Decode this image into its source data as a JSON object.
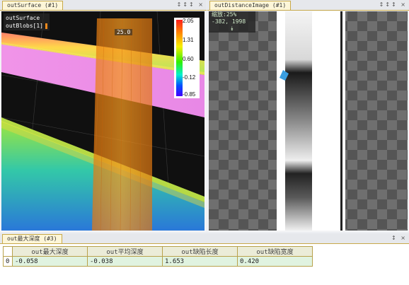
{
  "left_panel": {
    "tab_title": "outSurface (#1)",
    "controls": "↕↕↕ ×",
    "overlay_items": [
      "outSurface",
      "outBlobs[1]"
    ],
    "blob_label": "25.0",
    "colorbar": {
      "labels": [
        "2.05",
        "1.31",
        "0.60",
        "-0.12",
        "-0.85"
      ]
    }
  },
  "right_panel": {
    "tab_title": "outDistanceImage (#1)",
    "controls": "↕↕↕ ×",
    "info_lines": [
      "缩放:25%",
      "-382, 1998"
    ],
    "chevron": "⯯"
  },
  "bottom_panel": {
    "tab_title": "out最大深度 (#3)",
    "controls": "↕ ×",
    "table": {
      "headers": [
        "out最大深度",
        "out平均深度",
        "out缺陷长度",
        "out缺陷宽度"
      ],
      "rows": [
        {
          "index": "0",
          "cells": [
            "-0.058",
            "-0.038",
            "1.653",
            "0.420"
          ]
        }
      ]
    }
  }
}
